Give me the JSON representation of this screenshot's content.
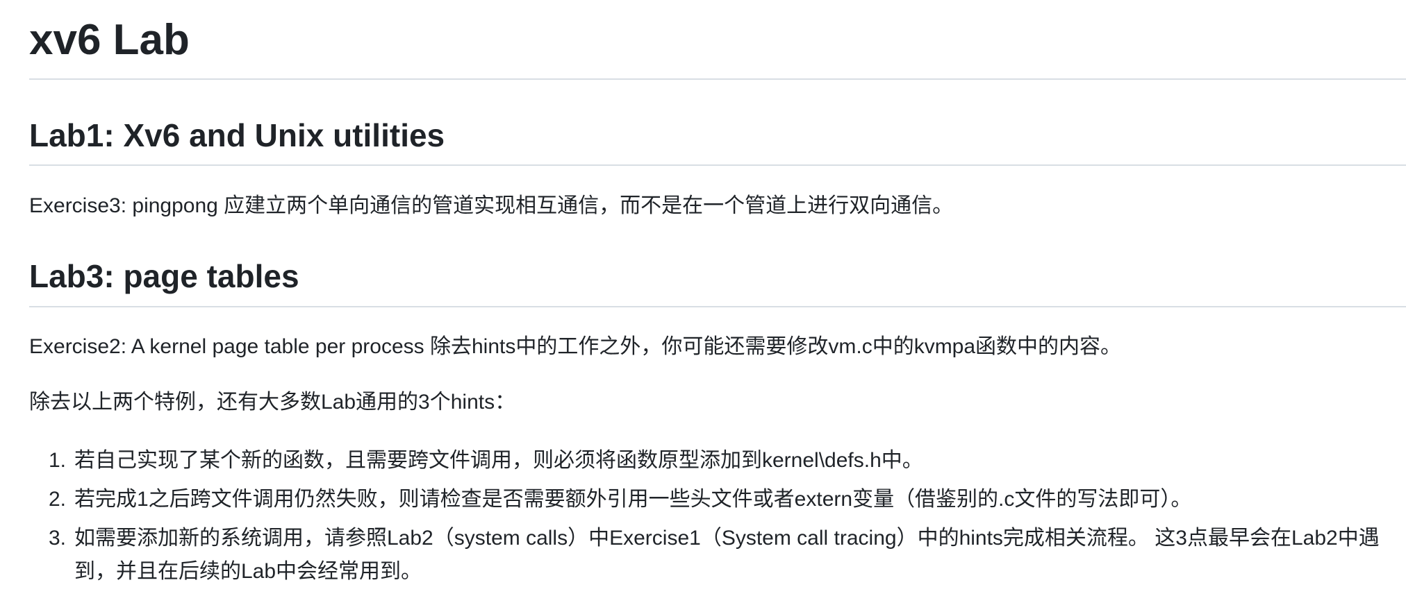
{
  "document": {
    "title": "xv6 Lab",
    "sections": [
      {
        "heading": "Lab1: Xv6 and Unix utilities",
        "paragraph": "Exercise3: pingpong 应建立两个单向通信的管道实现相互通信，而不是在一个管道上进行双向通信。"
      },
      {
        "heading": "Lab3: page tables",
        "paragraph": "Exercise2: A kernel page table per process 除去hints中的工作之外，你可能还需要修改vm.c中的kvmpa函数中的内容。"
      }
    ],
    "intro": "除去以上两个特例，还有大多数Lab通用的3个hints：",
    "list": [
      {
        "number": "1.",
        "text": "若自己实现了某个新的函数，且需要跨文件调用，则必须将函数原型添加到kernel\\defs.h中。"
      },
      {
        "number": "2.",
        "text": "若完成1之后跨文件调用仍然失败，则请检查是否需要额外引用一些头文件或者extern变量（借鉴别的.c文件的写法即可）。"
      },
      {
        "number": "3.",
        "text": "如需要添加新的系统调用，请参照Lab2（system calls）中Exercise1（System call tracing）中的hints完成相关流程。 这3点最早会在Lab2中遇到，并且在后续的Lab中会经常用到。"
      }
    ]
  }
}
